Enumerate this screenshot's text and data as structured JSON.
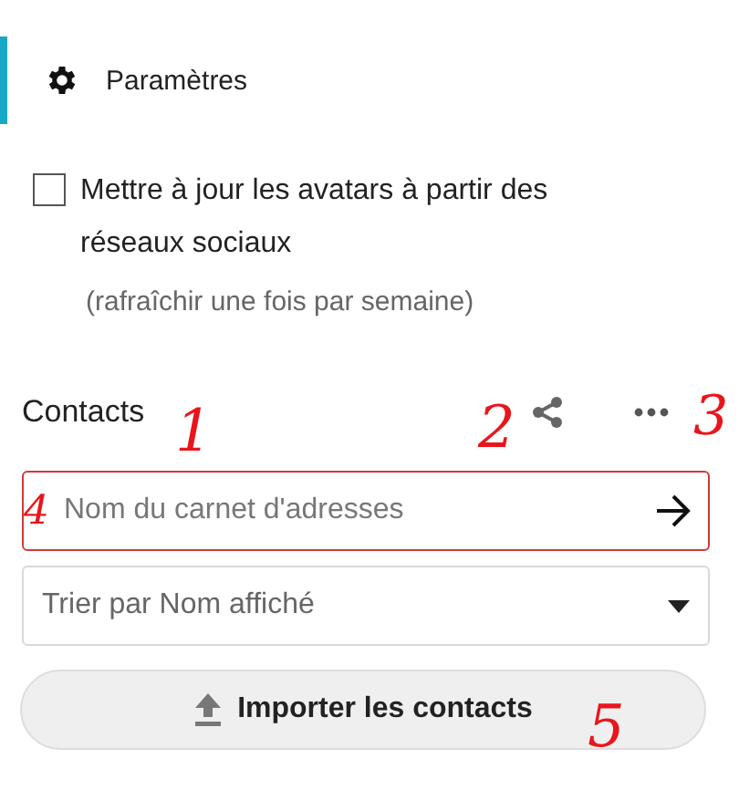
{
  "header": {
    "title": "Paramètres",
    "selected": true
  },
  "avatar_option": {
    "label": "Mettre à jour les avatars à partir des réseaux sociaux",
    "checked": false,
    "hint": "(rafraîchir une fois par semaine)"
  },
  "contacts": {
    "title": "Contacts"
  },
  "address_book_field": {
    "placeholder": "Nom du carnet d'adresses",
    "invalid": true
  },
  "sort_select": {
    "value": "Trier par Nom affiché"
  },
  "import_button": {
    "label": "Importer les contacts"
  },
  "annotations": [
    {
      "label": "1"
    },
    {
      "label": "2"
    },
    {
      "label": "3"
    },
    {
      "label": "4"
    },
    {
      "label": "5"
    }
  ]
}
